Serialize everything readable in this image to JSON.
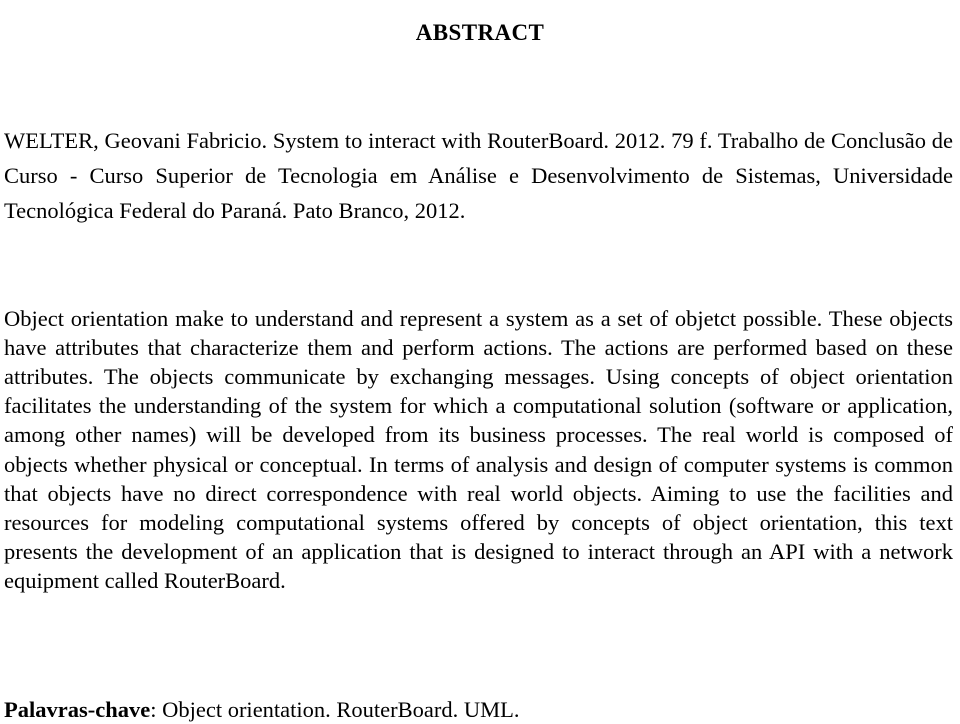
{
  "document": {
    "heading": "ABSTRACT",
    "citation": "WELTER, Geovani Fabricio. System to interact with RouterBoard. 2012. 79 f. Trabalho de Conclusão de Curso - Curso Superior de Tecnologia em Análise e Desenvolvimento de Sistemas, Universidade Tecnológica Federal do Paraná. Pato Branco, 2012.",
    "abstract_body": "Object orientation make to understand and represent a system as a set of objetct possible. These objects have attributes that characterize them and perform actions. The actions are performed based on these attributes. The objects communicate by exchanging messages. Using concepts of object orientation facilitates the understanding of the system for which a computational solution (software or application, among other names) will be developed from its business processes. The real world is composed of objects whether physical or conceptual. In terms of analysis and design of computer systems is common that objects have no direct correspondence with real world objects. Aiming to use the facilities and resources for modeling computational systems offered by concepts of object orientation, this text presents the development of an application that is designed to interact through an API with a network equipment called RouterBoard.",
    "keywords": {
      "label": "Palavras-chave",
      "values": ": Object orientation. RouterBoard. UML."
    },
    "colors": {
      "text": "#000000",
      "background": "#ffffff"
    }
  }
}
